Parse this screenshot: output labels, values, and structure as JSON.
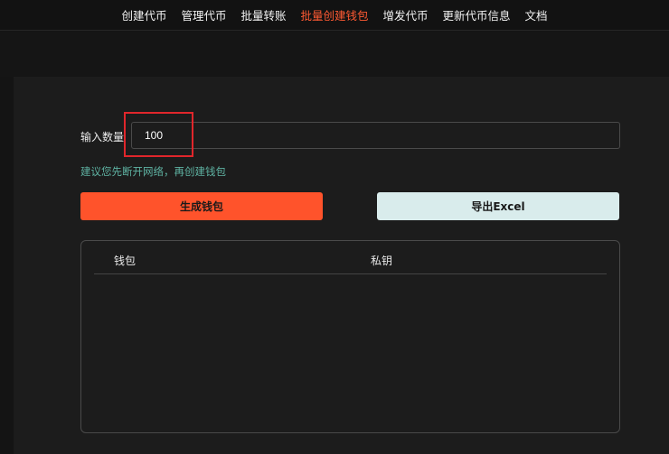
{
  "nav": {
    "items": [
      {
        "label": "创建代币",
        "active": false
      },
      {
        "label": "管理代币",
        "active": false
      },
      {
        "label": "批量转账",
        "active": false
      },
      {
        "label": "批量创建钱包",
        "active": true
      },
      {
        "label": "增发代币",
        "active": false
      },
      {
        "label": "更新代币信息",
        "active": false
      },
      {
        "label": "文档",
        "active": false
      }
    ]
  },
  "form": {
    "quantity_label": "输入数量",
    "quantity_value": "100",
    "hint": "建议您先断开网络，再创建钱包"
  },
  "buttons": {
    "generate_label": "生成钱包",
    "export_label": "导出Excel"
  },
  "table": {
    "columns": [
      "钱包",
      "私钥"
    ],
    "rows": []
  },
  "colors": {
    "accent": "#ff532b",
    "active_nav": "#ff5a33",
    "export_bg": "#d9ecec",
    "hint": "#5fb3a3",
    "highlight": "#e0262b"
  }
}
